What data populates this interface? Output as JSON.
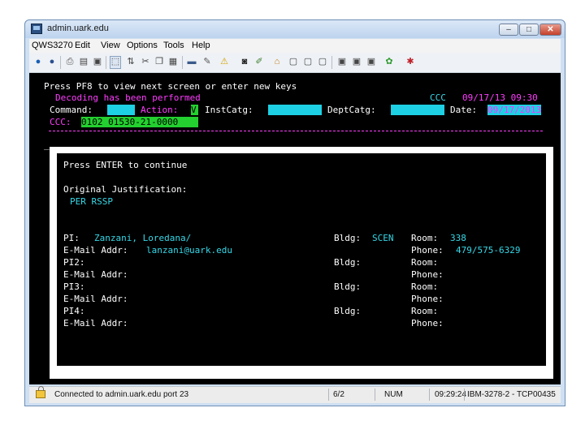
{
  "window": {
    "title": "admin.uark.edu",
    "controls": {
      "minimize": "–",
      "maximize": "□",
      "close": "✕"
    }
  },
  "menu": [
    "QWS3270",
    "Edit",
    "View",
    "Options",
    "Tools",
    "Help"
  ],
  "toolbar_icons": [
    "connect-icon",
    "disconnect-icon",
    "print-icon",
    "screen-print-icon",
    "save-icon",
    "select-icon",
    "transfer-icon",
    "cut-icon",
    "copy-icon",
    "paste-icon",
    "keyboard-icon",
    "macro-icon",
    "warning-icon",
    "camera-icon",
    "edit-icon",
    "home-icon",
    "window1-icon",
    "window2-icon",
    "window3-icon",
    "window4-icon",
    "window5-icon",
    "window6-icon",
    "green-icon",
    "bug-icon"
  ],
  "terminal": {
    "line1": "Press PF8 to view next screen or enter new keys",
    "line2": "Decoding has been performed",
    "ccc_date_label": "CCC",
    "ccc_date_value": "09/17/13 09:30",
    "command_label": "Command:",
    "action_label": "Action:",
    "action_value": "V",
    "instcatg_label": "InstCatg:",
    "deptcatg_label": "DeptCatg:",
    "date_label": "Date:",
    "date_value": "09/17/2013",
    "ccc_label": "CCC:",
    "ccc_value": "0102 01530-21-0000",
    "underscore": "_"
  },
  "popup": {
    "press_enter": "Press ENTER to continue",
    "orig_just_label": "Original Justification:",
    "orig_just_value": "PER RSSP",
    "pi_label": "PI:",
    "pi_name": "Zanzani, Loredana/",
    "bldg_label": "Bldg:",
    "bldg_value": "SCEN",
    "room_label": "Room:",
    "room_value": "338",
    "email_label": "E-Mail Addr:",
    "email_value": "lanzani@uark.edu",
    "phone_label": "Phone:",
    "phone_value": "479/575-6329",
    "pi2_label": "PI2:",
    "pi3_label": "PI3:",
    "pi4_label": "PI4:"
  },
  "status": {
    "connection": "Connected to admin.uark.edu port 23",
    "cursor": "6/2",
    "num": "NUM",
    "time": "09:29:24",
    "terminal_type": "IBM-3278-2 - TCP00435"
  }
}
